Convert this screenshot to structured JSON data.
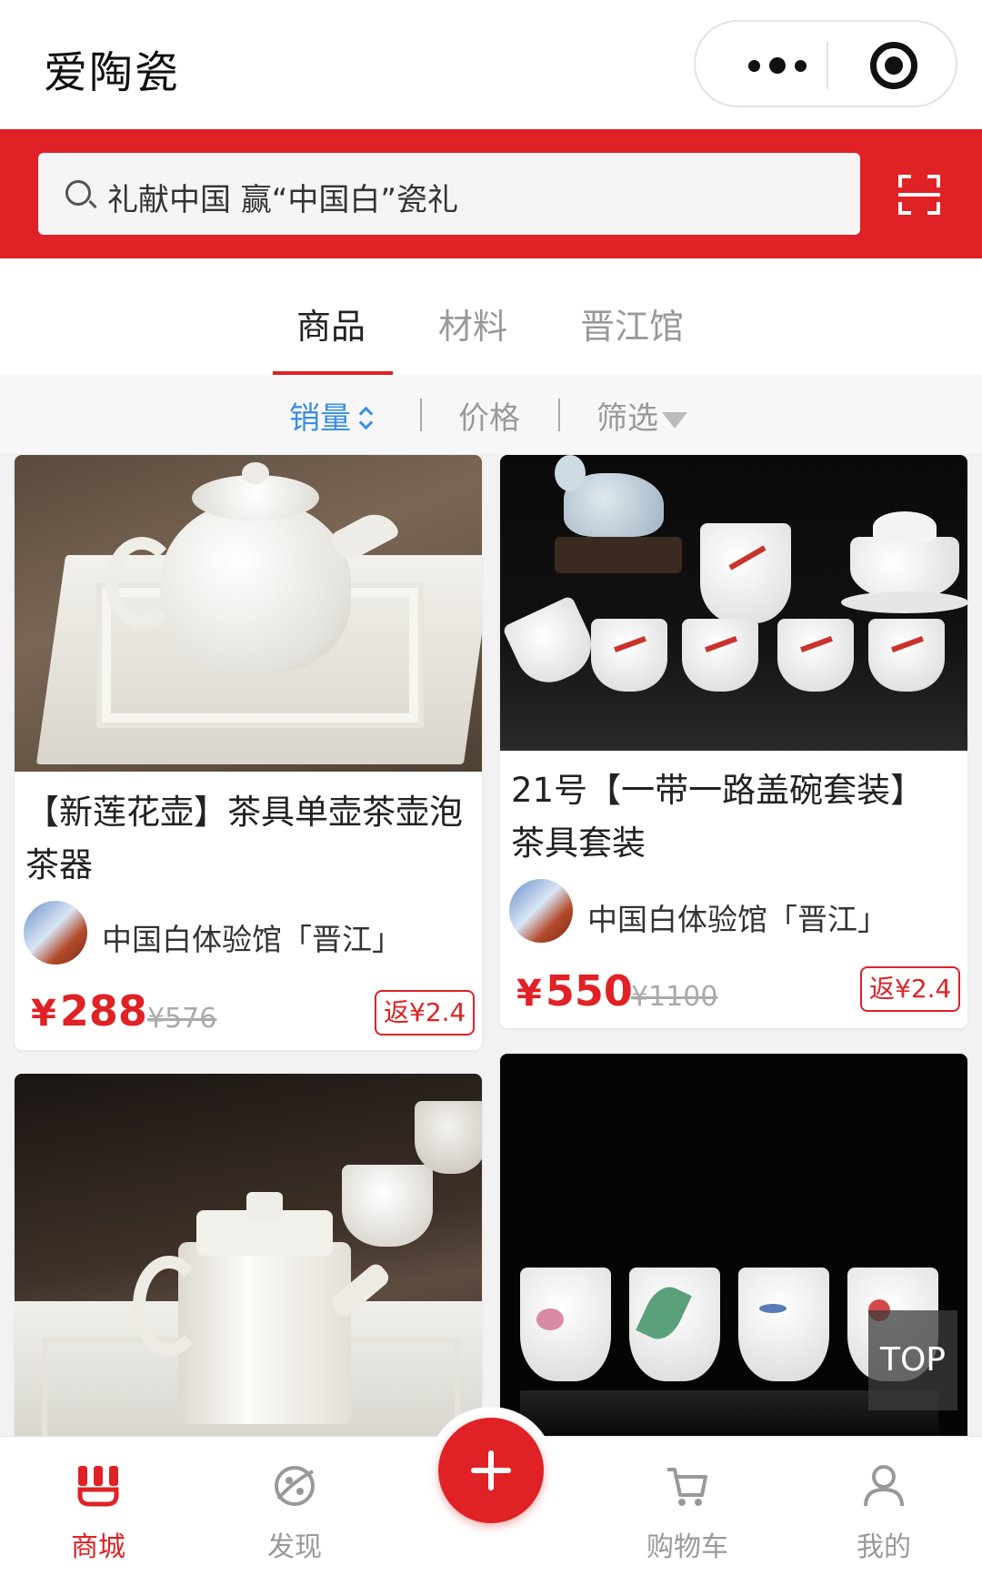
{
  "app": {
    "title": "爱陶瓷"
  },
  "search": {
    "placeholder": "礼献中国 赢“中国白”瓷礼"
  },
  "tabs": [
    {
      "label": "商品",
      "active": true
    },
    {
      "label": "材料",
      "active": false
    },
    {
      "label": "晋江馆",
      "active": false
    }
  ],
  "sort": {
    "sales": "销量",
    "price": "价格",
    "filter": "筛选"
  },
  "products": [
    {
      "name": "【新莲花壶】茶具单壶茶壶泡茶器",
      "shop": "中国白体验馆「晋江」",
      "price": "288",
      "currency": "¥",
      "original": "¥576",
      "rebate": "返¥2.4"
    },
    {
      "name": "21号【一带一路盖碗套装】茶具套装",
      "shop": "中国白体验馆「晋江」",
      "price": "550",
      "currency": "¥",
      "original": "¥1100",
      "rebate": "返¥2.4"
    }
  ],
  "top_button": "TOP",
  "nav": [
    {
      "label": "商城",
      "icon": "store-icon",
      "active": true
    },
    {
      "label": "发现",
      "icon": "discover-icon",
      "active": false
    },
    {
      "label": "购物车",
      "icon": "cart-icon",
      "active": false
    },
    {
      "label": "我的",
      "icon": "user-icon",
      "active": false
    }
  ],
  "colors": {
    "brand_red": "#e02125",
    "accent_blue": "#3a8ee6"
  }
}
